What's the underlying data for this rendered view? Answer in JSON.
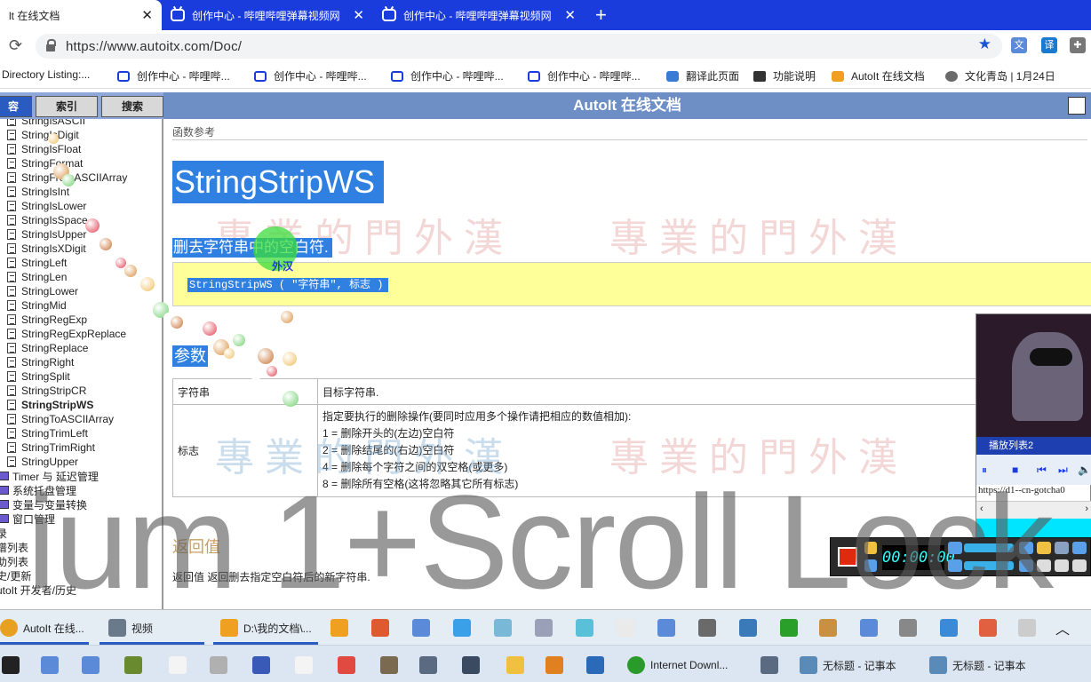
{
  "browser": {
    "tabs": [
      {
        "title": "lt 在线文档",
        "active": true
      },
      {
        "title": "创作中心 - 哔哩哔哩弹幕视频网",
        "active": false
      },
      {
        "title": "创作中心 - 哔哩哔哩弹幕视频网",
        "active": false
      }
    ],
    "url": "https://www.autoitx.com/Doc/",
    "bookmarks": [
      "Directory Listing:...",
      "创作中心 - 哔哩哔...",
      "创作中心 - 哔哩哔...",
      "创作中心 - 哔哩哔...",
      "创作中心 - 哔哩哔...",
      "翻译此页面",
      "功能说明",
      "AutoIt 在线文档",
      "文化青岛 | 1月24日"
    ]
  },
  "help": {
    "header_title": "AutoIt 在线文档",
    "side_tabs": [
      "容",
      "索引",
      "搜索"
    ],
    "tree": [
      {
        "label": "StringIsASCII",
        "type": "doc"
      },
      {
        "label": "StringIsDigit",
        "type": "doc"
      },
      {
        "label": "StringIsFloat",
        "type": "doc"
      },
      {
        "label": "StringFormat",
        "type": "doc"
      },
      {
        "label": "StringFromASCIIArray",
        "type": "doc"
      },
      {
        "label": "StringIsInt",
        "type": "doc"
      },
      {
        "label": "StringIsLower",
        "type": "doc"
      },
      {
        "label": "StringIsSpace",
        "type": "doc"
      },
      {
        "label": "StringIsUpper",
        "type": "doc"
      },
      {
        "label": "StringIsXDigit",
        "type": "doc"
      },
      {
        "label": "StringLeft",
        "type": "doc"
      },
      {
        "label": "StringLen",
        "type": "doc"
      },
      {
        "label": "StringLower",
        "type": "doc"
      },
      {
        "label": "StringMid",
        "type": "doc"
      },
      {
        "label": "StringRegExp",
        "type": "doc"
      },
      {
        "label": "StringRegExpReplace",
        "type": "doc"
      },
      {
        "label": "StringReplace",
        "type": "doc"
      },
      {
        "label": "StringRight",
        "type": "doc"
      },
      {
        "label": "StringSplit",
        "type": "doc"
      },
      {
        "label": "StringStripCR",
        "type": "doc"
      },
      {
        "label": "StringStripWS",
        "type": "doc",
        "selected": true
      },
      {
        "label": "StringToASCIIArray",
        "type": "doc"
      },
      {
        "label": "StringTrimLeft",
        "type": "doc"
      },
      {
        "label": "StringTrimRight",
        "type": "doc"
      },
      {
        "label": "StringUpper",
        "type": "doc"
      },
      {
        "label": "Timer 与 延迟管理",
        "type": "book"
      },
      {
        "label": "系统托盘管理",
        "type": "book"
      },
      {
        "label": "变量与变量转换",
        "type": "book"
      },
      {
        "label": "窗口管理",
        "type": "book"
      },
      {
        "label": "录",
        "type": "root"
      },
      {
        "label": "谱列表",
        "type": "root"
      },
      {
        "label": "助列表",
        "type": "root"
      },
      {
        "label": "史/更新",
        "type": "root"
      },
      {
        "label": "utoIt 开发者/历史",
        "type": "root"
      }
    ],
    "breadcrumb": "函数参考",
    "function_name": "StringStripWS",
    "description": "删去字符串中的空白符.",
    "syntax": "StringStripWS ( \"字符串\", 标志 )",
    "params_heading": "参数",
    "params": [
      {
        "name": "字符串",
        "desc": [
          "目标字符串."
        ]
      },
      {
        "name": "标志",
        "desc": [
          "指定要执行的删除操作(要同时应用多个操作请把相应的数值相加):",
          "1 = 删除开头的(左边)空白符",
          "2 = 删除结尾的(右边)空白符",
          "4 = 删除每个字符之间的双空格(或更多)",
          "8 = 删除所有空格(这将忽略其它所有标志)"
        ]
      }
    ],
    "return_heading": "返回值",
    "return_text": "返回值 返回删去指定空白符后的新字符串.",
    "watermark": "專業的門外漢",
    "cursor_label": "外汉"
  },
  "overlay_text": "ium 1+Scroll Lock",
  "player": {
    "playlist_label": "播放列表2",
    "url": "https://d1--cn-gotcha0"
  },
  "recorder": {
    "time": "00:00:00"
  },
  "taskbar1": [
    {
      "label": "AutoIt 在线...",
      "color": "#e8a020"
    },
    {
      "label": "视频",
      "color": "#6a7a8a"
    },
    {
      "label": "D:\\我的文档\\...",
      "color": "#f0a020"
    }
  ],
  "taskbar2": [
    {
      "label": "Internet Downl...",
      "color": "#2a9a2a"
    },
    {
      "label": "无标题 - 记事本",
      "color": "#5a8ab8"
    },
    {
      "label": "无标题 - 记事本",
      "color": "#5a8ab8"
    }
  ],
  "colors": {
    "tabbar": "#1a3cdc",
    "highlight": "#2f80e0",
    "syntax_bg": "#ffff99",
    "header": "#6d8fc6"
  }
}
